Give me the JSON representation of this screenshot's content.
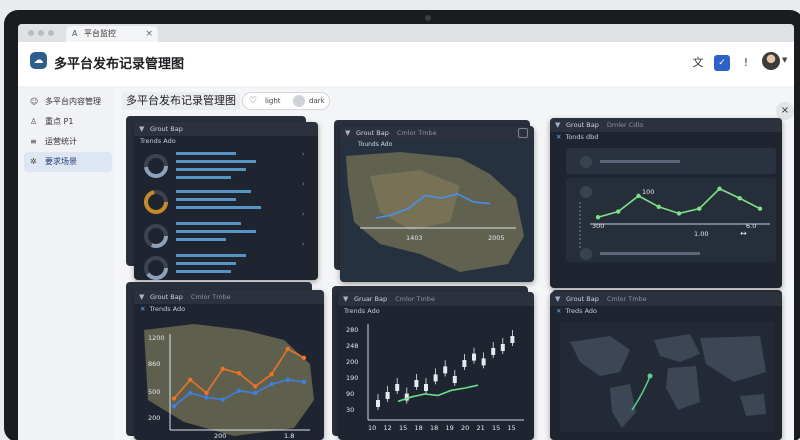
{
  "browser": {
    "tab_title": "平台监控",
    "tab_icon": "A",
    "tab_close": "×"
  },
  "app": {
    "title": "多平台发布记录管理图",
    "title_caret": "⌄",
    "header_icons": {
      "translate": "文",
      "check": "✓",
      "alert": "!"
    }
  },
  "sidebar": {
    "items": [
      {
        "label": "多平台内容管理",
        "icon": "people-icon"
      },
      {
        "label": "重点 P1",
        "icon": "person-icon"
      },
      {
        "label": "运营统计",
        "icon": "list-icon"
      },
      {
        "label": "要求场景",
        "icon": "gear-icon",
        "active": true
      }
    ]
  },
  "main": {
    "title": "多平台发布记录管理图",
    "toggle": {
      "heart": "♡",
      "light_label": "light",
      "dark_label": "dark"
    },
    "close": "×"
  },
  "cards": {
    "c1": {
      "header": "Grout Bap",
      "extra": "",
      "sub": "Trends Ado"
    },
    "c2": {
      "header": "Grout Bap",
      "extra": "Cmlor Tmbe",
      "sub": "Tounds Ado"
    },
    "c3": {
      "header": "Grout Bap",
      "extra": "Dmler Cdlo",
      "sub": "Tonds dbd"
    },
    "c4": {
      "header": "Grout Bap",
      "extra": "Cmlor Tmbe",
      "sub": "Trends Ado"
    },
    "c5": {
      "header": "Gruar Bap",
      "extra": "Cmlor Tmbe",
      "sub": "Trends Ado"
    },
    "c6": {
      "header": "Grout Bap",
      "extra": "Cmlor Tmbe",
      "sub": "Treds Ado"
    }
  },
  "chart_data": [
    {
      "type": "line",
      "title": "Tounds Ado",
      "x_ticks": [
        "1403",
        "2005"
      ],
      "series": [
        {
          "values": [
            30,
            34,
            42,
            58,
            55,
            60,
            50,
            48
          ]
        }
      ]
    },
    {
      "type": "line",
      "title": "Tonds dbd",
      "y_ticks": [
        "100",
        "1.00"
      ],
      "x_ticks": [
        "300",
        "6.0"
      ],
      "series": [
        {
          "values": [
            10,
            22,
            55,
            32,
            18,
            28,
            70,
            50,
            28
          ]
        }
      ]
    },
    {
      "type": "line",
      "title": "Trends Ado",
      "y_ticks": [
        "1200",
        "860",
        "500",
        "200"
      ],
      "x_ticks": [
        "200",
        "1.8"
      ],
      "series": [
        {
          "values": [
            250,
            420,
            300,
            520,
            480,
            360,
            470,
            700,
            620
          ]
        },
        {
          "values": [
            180,
            300,
            260,
            240,
            320,
            300,
            380,
            420,
            400
          ]
        }
      ]
    },
    {
      "type": "bar",
      "title": "Trends Ado",
      "y_ticks": [
        "280",
        "248",
        "200",
        "190",
        "90",
        "30"
      ],
      "x_ticks": [
        "10",
        "12",
        "15",
        "18",
        "18",
        "19",
        "20",
        "21",
        "15",
        "15"
      ],
      "values": [
        20,
        30,
        40,
        28,
        45,
        40,
        52,
        62,
        50,
        70,
        78,
        72,
        85,
        90,
        100
      ],
      "series": [
        {
          "values": [
            20,
            26,
            30,
            28,
            35,
            38,
            42
          ]
        }
      ]
    }
  ]
}
